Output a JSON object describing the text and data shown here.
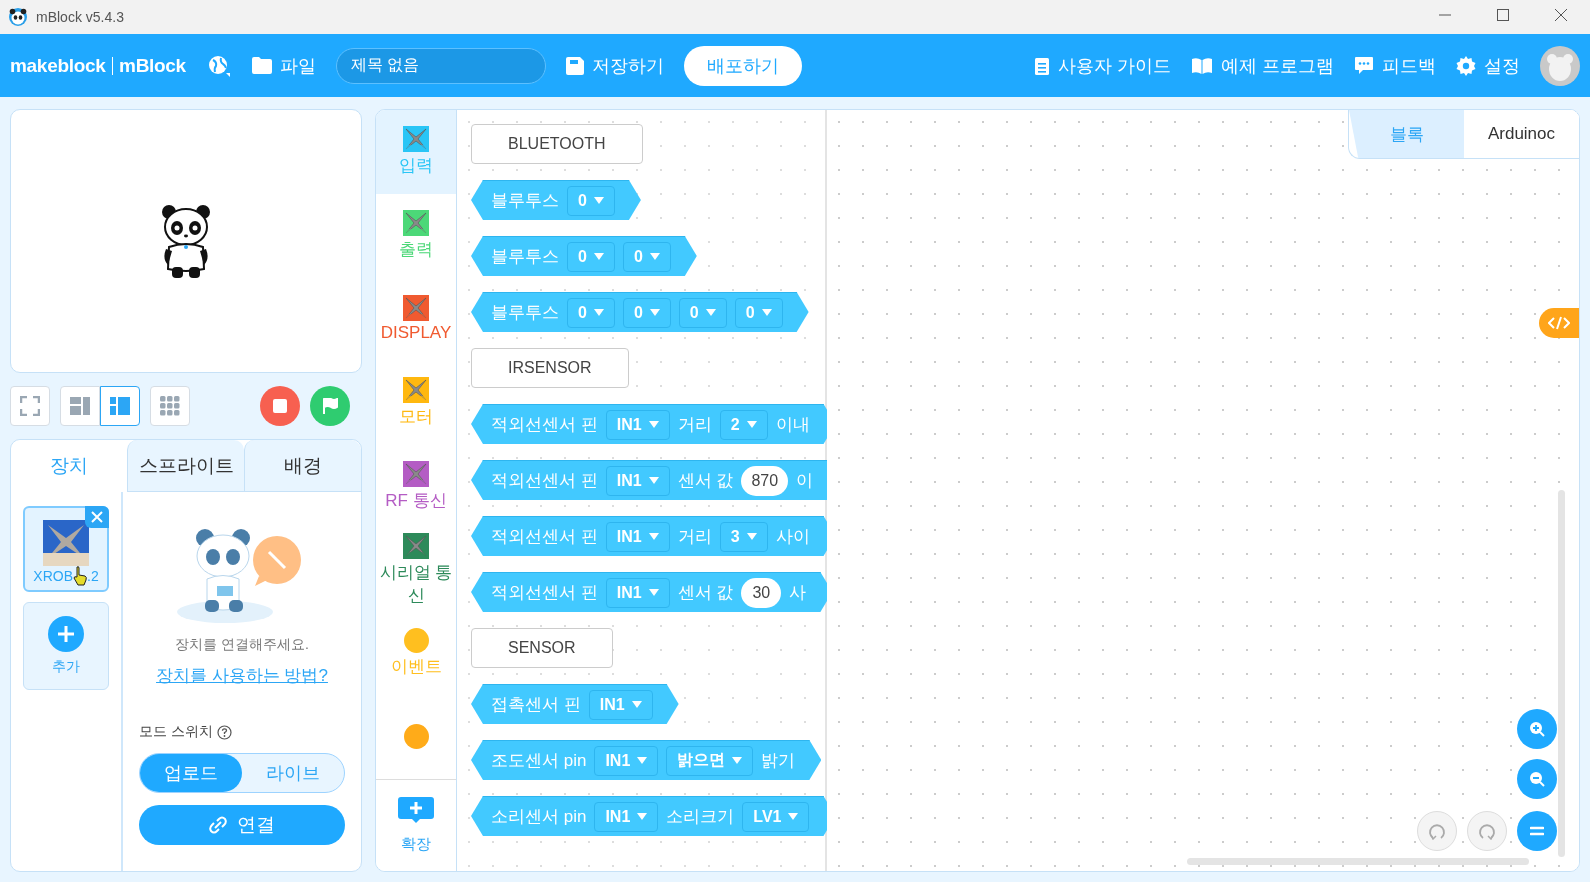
{
  "window": {
    "title": "mBlock v5.4.3"
  },
  "topbar": {
    "brand_left": "makeblock",
    "brand_right": "mBlock",
    "file_menu": "파일",
    "project_title": "제목 없음",
    "save": "저장하기",
    "publish": "배포하기",
    "right_items": [
      {
        "kind": "guide",
        "label": "사용자 가이드"
      },
      {
        "kind": "examples",
        "label": "예제 프로그램"
      },
      {
        "kind": "feedback",
        "label": "피드백"
      },
      {
        "kind": "settings",
        "label": "설정"
      }
    ]
  },
  "stage_toolbar": {
    "layouts": [
      {
        "kind": "small",
        "selected": false
      },
      {
        "kind": "large",
        "selected": true
      }
    ]
  },
  "left_tabs": [
    {
      "label": "장치",
      "selected": true
    },
    {
      "label": "스프라이트",
      "selected": false
    },
    {
      "label": "배경",
      "selected": false
    }
  ],
  "device": {
    "name_visible_start": "XROB",
    "name_visible_end": ".2",
    "add_label": "추가"
  },
  "connect_panel": {
    "message": "장치를 연결해주세요.",
    "help_link": "장치를 사용하는 방법?",
    "mode_label": "모드 스위치",
    "modes": [
      {
        "label": "업로드",
        "selected": true
      },
      {
        "label": "라이브",
        "selected": false
      }
    ],
    "connect_button": "연결"
  },
  "categories": [
    {
      "kind": "robo",
      "label": "입력",
      "color": "#29c5f6",
      "selected": true
    },
    {
      "kind": "robo",
      "label": "출력",
      "color": "#4cd878",
      "selected": false
    },
    {
      "kind": "robo",
      "label": "DISPLAY",
      "color": "#f05a30",
      "selected": false
    },
    {
      "kind": "robo",
      "label": "모터",
      "color": "#ffb80f",
      "selected": false
    },
    {
      "kind": "robo",
      "label": "RF 통신",
      "color": "#b45cc4",
      "selected": false
    },
    {
      "kind": "robo",
      "label": "시리얼 통신",
      "color": "#2d8a5a",
      "selected": false
    },
    {
      "kind": "dot",
      "label": "이벤트",
      "color": "#ffbf1f",
      "selected": false
    },
    {
      "kind": "dot",
      "color": "#ffab19",
      "selected": false
    }
  ],
  "extension_label": "확장",
  "palette": [
    {
      "kind": "label",
      "text": "BLUETOOTH"
    },
    {
      "kind": "block",
      "parts": [
        {
          "kind": "text",
          "text": "블루투스"
        },
        {
          "kind": "dropdown",
          "value": "0"
        }
      ]
    },
    {
      "kind": "block",
      "parts": [
        {
          "kind": "text",
          "text": "블루투스"
        },
        {
          "kind": "dropdown",
          "value": "0"
        },
        {
          "kind": "dropdown",
          "value": "0"
        }
      ]
    },
    {
      "kind": "block",
      "parts": [
        {
          "kind": "text",
          "text": "블루투스"
        },
        {
          "kind": "dropdown",
          "value": "0"
        },
        {
          "kind": "dropdown",
          "value": "0"
        },
        {
          "kind": "dropdown",
          "value": "0"
        },
        {
          "kind": "dropdown",
          "value": "0"
        }
      ]
    },
    {
      "kind": "label",
      "text": "IRSENSOR"
    },
    {
      "kind": "block",
      "parts": [
        {
          "kind": "text",
          "text": "적외선센서 핀"
        },
        {
          "kind": "dropdown",
          "value": "IN1"
        },
        {
          "kind": "text",
          "text": "거리"
        },
        {
          "kind": "dropdown",
          "value": "2"
        },
        {
          "kind": "text",
          "text": "이내"
        }
      ]
    },
    {
      "kind": "block",
      "parts": [
        {
          "kind": "text",
          "text": "적외선센서 핀"
        },
        {
          "kind": "dropdown",
          "value": "IN1"
        },
        {
          "kind": "text",
          "text": "센서 값"
        },
        {
          "kind": "number",
          "value": "870"
        },
        {
          "kind": "text",
          "text": "이"
        }
      ]
    },
    {
      "kind": "block",
      "parts": [
        {
          "kind": "text",
          "text": "적외선센서 핀"
        },
        {
          "kind": "dropdown",
          "value": "IN1"
        },
        {
          "kind": "text",
          "text": "거리"
        },
        {
          "kind": "dropdown",
          "value": "3"
        },
        {
          "kind": "text",
          "text": "사이"
        }
      ]
    },
    {
      "kind": "block",
      "parts": [
        {
          "kind": "text",
          "text": "적외선센서 핀"
        },
        {
          "kind": "dropdown",
          "value": "IN1"
        },
        {
          "kind": "text",
          "text": "센서 값"
        },
        {
          "kind": "number",
          "value": "30"
        },
        {
          "kind": "text",
          "text": "사"
        }
      ]
    },
    {
      "kind": "label",
      "text": "SENSOR"
    },
    {
      "kind": "block",
      "parts": [
        {
          "kind": "text",
          "text": "접촉센서 핀"
        },
        {
          "kind": "dropdown",
          "value": "IN1"
        }
      ]
    },
    {
      "kind": "block",
      "parts": [
        {
          "kind": "text",
          "text": "조도센서 pin"
        },
        {
          "kind": "dropdown",
          "value": "IN1"
        },
        {
          "kind": "dropdown",
          "value": "밝으면"
        },
        {
          "kind": "text",
          "text": "밝기"
        }
      ]
    },
    {
      "kind": "block",
      "parts": [
        {
          "kind": "text",
          "text": "소리센서 pin"
        },
        {
          "kind": "dropdown",
          "value": "IN1"
        },
        {
          "kind": "text",
          "text": "소리크기"
        },
        {
          "kind": "dropdown",
          "value": "LV1"
        }
      ]
    }
  ],
  "workspace_tabs": [
    {
      "label": "블록",
      "selected": true
    },
    {
      "label": "Arduinoc",
      "selected": false
    }
  ]
}
